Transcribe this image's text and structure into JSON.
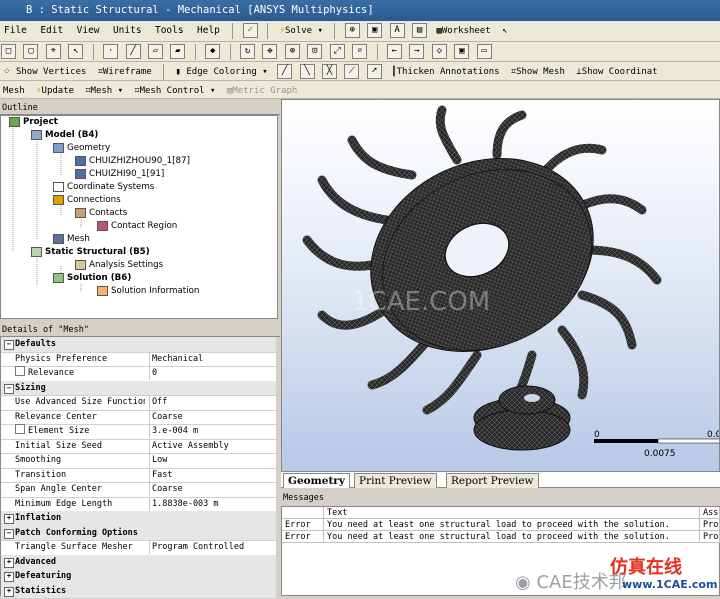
{
  "window": {
    "title": "B : Static Structural - Mechanical [ANSYS Multiphysics]",
    "logo": "B"
  },
  "menu": [
    "File",
    "Edit",
    "View",
    "Units",
    "Tools",
    "Help"
  ],
  "toolbar1": {
    "solve_label": "Solve",
    "worksheet_label": "Worksheet"
  },
  "toolbar2": {
    "show_vertices": "Show Vertices",
    "wireframe": "Wireframe",
    "edge_coloring": "Edge Coloring",
    "thicken_annotations": "Thicken Annotations",
    "show_mesh": "Show Mesh",
    "show_coordinate": "Show Coordinat"
  },
  "toolbar3": {
    "mesh_label": "Mesh",
    "update_label": "Update",
    "mesh_button": "Mesh",
    "mesh_control": "Mesh Control",
    "metric_graph": "Metric Graph"
  },
  "outline": {
    "title": "Outline",
    "nodes": [
      "Project",
      "Model (B4)",
      "Geometry",
      "CHUIZHIZHOU90_1[87]",
      "CHUIZHI90_1[91]",
      "Coordinate Systems",
      "Connections",
      "Contacts",
      "Contact Region",
      "Mesh",
      "Static Structural (B5)",
      "Analysis Settings",
      "Solution (B6)",
      "Solution Information"
    ]
  },
  "details": {
    "title": "Details of \"Mesh\"",
    "rows": [
      {
        "k": "Defaults",
        "group": true
      },
      {
        "k": "Physics Preference",
        "v": "Mechanical"
      },
      {
        "k": "Relevance",
        "v": "0",
        "check": true
      },
      {
        "k": "Sizing",
        "group": true
      },
      {
        "k": "Use Advanced Size Function",
        "v": "Off"
      },
      {
        "k": "Relevance Center",
        "v": "Coarse"
      },
      {
        "k": "Element Size",
        "v": "3.e-004 m",
        "check": true
      },
      {
        "k": "Initial Size Seed",
        "v": "Active Assembly"
      },
      {
        "k": "Smoothing",
        "v": "Low"
      },
      {
        "k": "Transition",
        "v": "Fast"
      },
      {
        "k": "Span Angle Center",
        "v": "Coarse"
      },
      {
        "k": "Minimum Edge Length",
        "v": "1.8838e-003 m"
      },
      {
        "k": "Inflation",
        "group": true
      },
      {
        "k": "Patch Conforming Options",
        "group": true
      },
      {
        "k": "Triangle Surface Mesher",
        "v": "Program Controlled"
      },
      {
        "k": "Advanced",
        "group": true
      },
      {
        "k": "Defeaturing",
        "group": true
      },
      {
        "k": "Statistics",
        "group": true
      }
    ]
  },
  "viewport": {
    "scale_left": "0",
    "scale_mid": "0.0075",
    "scale_right": "0.0",
    "watermark": "1CAE.COM"
  },
  "tabs": [
    "Geometry",
    "Print Preview",
    "Report Preview"
  ],
  "messages": {
    "title": "Messages",
    "headers": [
      "",
      "Text",
      "Ass"
    ],
    "rows": [
      {
        "type": "Error",
        "text": "You need at least one structural load to proceed with the solution.",
        "assoc": "Pro"
      },
      {
        "type": "Error",
        "text": "You need at least one structural load to proceed with the solution.",
        "assoc": "Pro"
      }
    ]
  },
  "footer": {
    "brand": "仿真在线",
    "site": "www.1CAE.com",
    "wechat": "CAE技术邦"
  }
}
